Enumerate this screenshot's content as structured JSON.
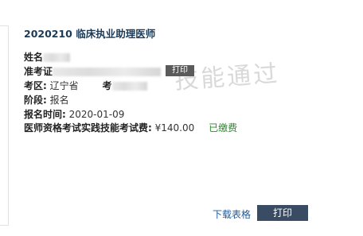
{
  "exam": {
    "title": "2020210 临床执业助理医师",
    "watermark": "技能通过"
  },
  "fields": {
    "name_label": "姓名",
    "admission_label": "准考证",
    "area_label": "考区:",
    "area_value": "辽宁省",
    "site_label": "考",
    "stage_label": "阶段:",
    "stage_value": "报名",
    "reg_time_label": "报名时间:",
    "reg_time_value": "2020-01-09",
    "fee_label": "医师资格考试实践技能考试费:",
    "fee_value": "¥140.00",
    "fee_status": "已缴费"
  },
  "actions": {
    "print_badge": "打印",
    "download_link": "下载表格",
    "print_button": "打印"
  },
  "colors": {
    "title": "#1b3a57",
    "paid": "#2a8a2a",
    "print_button_bg": "#3a4c63",
    "link": "#1e5a9a"
  }
}
